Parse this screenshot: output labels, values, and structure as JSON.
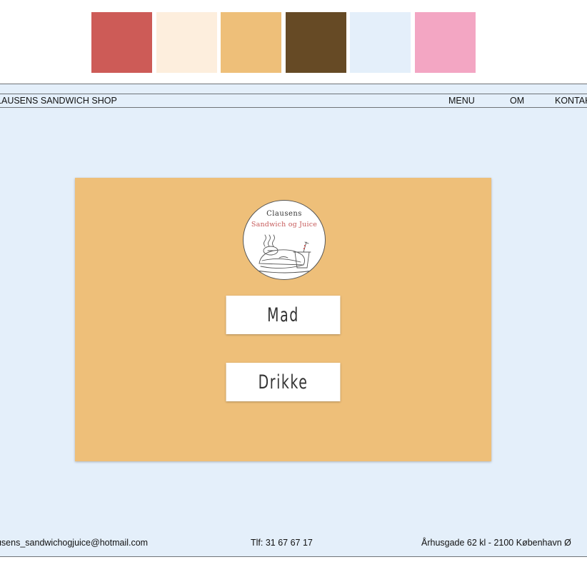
{
  "palette": {
    "colors": [
      "#cd5b57",
      "#fdeedd",
      "#eebf79",
      "#664a25",
      "#e4effa",
      "#f3a6c3"
    ]
  },
  "nav": {
    "brand": "CLAUSENS SANDWICH SHOP",
    "links": [
      "MENU",
      "OM",
      "KONTAKT"
    ]
  },
  "logo": {
    "line1": "Clausens",
    "line2": "Sandwich og Juice"
  },
  "categories": {
    "food": "Mad",
    "drinks": "Drikke"
  },
  "footer": {
    "email": "clausens_sandwichogjuice@hotmail.com",
    "phone": "Tlf: 31 67 67 17",
    "address": "Århusgade 62 kl - 2100 København Ø"
  },
  "colors": {
    "background": "#e4effa",
    "card": "#eebf79",
    "accent_red": "#cd5b57"
  }
}
